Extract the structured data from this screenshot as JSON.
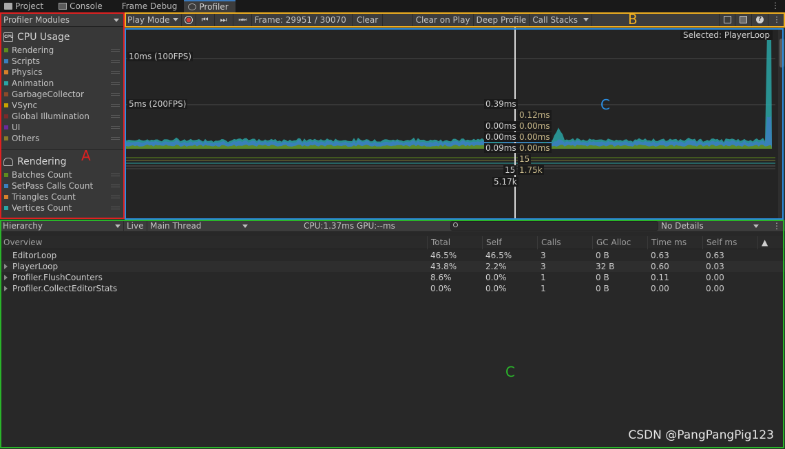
{
  "tabs": [
    {
      "label": "Project",
      "icon": "folder-icon",
      "active": false
    },
    {
      "label": "Console",
      "icon": "console-icon",
      "active": false
    },
    {
      "label": "Frame Debug",
      "icon": "",
      "active": false
    },
    {
      "label": "Profiler",
      "icon": "profiler-icon",
      "active": true
    }
  ],
  "tab_menu": "⋮",
  "modules": {
    "header": "Profiler Modules",
    "cpu": {
      "title": "CPU Usage",
      "badge": "CPU",
      "items": [
        {
          "label": "Rendering",
          "color": "#5f8c1d"
        },
        {
          "label": "Scripts",
          "color": "#3b7fbd"
        },
        {
          "label": "Physics",
          "color": "#d6802c"
        },
        {
          "label": "Animation",
          "color": "#2aa5a5"
        },
        {
          "label": "GarbageCollector",
          "color": "#8a4a2a"
        },
        {
          "label": "VSync",
          "color": "#c7a400"
        },
        {
          "label": "Global Illumination",
          "color": "#7a2a2a"
        },
        {
          "label": "UI",
          "color": "#6a2a9a"
        },
        {
          "label": "Others",
          "color": "#8a7a2a"
        }
      ]
    },
    "rendering": {
      "title": "Rendering",
      "items": [
        {
          "label": "Batches Count",
          "color": "#5f8c1d"
        },
        {
          "label": "SetPass Calls Count",
          "color": "#3b7fbd"
        },
        {
          "label": "Triangles Count",
          "color": "#d6802c"
        },
        {
          "label": "Vertices Count",
          "color": "#2aa5a5"
        }
      ]
    }
  },
  "toolbar": {
    "play_mode": "Play Mode",
    "prev_frame": "⏮",
    "next_frame": "⏭",
    "last_frame": "⏭⏭",
    "frame_label": "Frame: 29951 / 30070",
    "clear": "Clear",
    "clear_on_play": "Clear on Play",
    "deep_profile": "Deep Profile",
    "call_stacks": "Call Stacks",
    "help": "?"
  },
  "chart": {
    "selected": "Selected: PlayerLoop",
    "ms_10": "10ms (100FPS)",
    "ms_5": "5ms (200FPS)",
    "cursor_labels": {
      "left": [
        "0.39ms",
        "0.00ms",
        "0.00ms",
        "0.09ms",
        "15",
        "5.17k"
      ],
      "right": [
        "0.12ms",
        "0.00ms",
        "0.00ms",
        "0.00ms",
        "15",
        "1.75k"
      ]
    },
    "colors": {
      "scripts": "#3b7fbd",
      "rendering": "#5f8c1d",
      "teal": "#2aa5a5",
      "vsync": "#c7a400",
      "cursor": "#d9d9d9"
    }
  },
  "details": {
    "view": "Hierarchy",
    "live": "Live",
    "thread": "Main Thread",
    "timing": "CPU:1.37ms   GPU:--ms",
    "no_details": "No Details",
    "columns": [
      "Overview",
      "Total",
      "Self",
      "Calls",
      "GC Alloc",
      "Time ms",
      "Self ms",
      "▲"
    ],
    "rows": [
      {
        "name": "EditorLoop",
        "total": "46.5%",
        "self": "46.5%",
        "calls": "3",
        "gc": "0 B",
        "time": "0.63",
        "selfms": "0.63",
        "expandable": false
      },
      {
        "name": "PlayerLoop",
        "total": "43.8%",
        "self": "2.2%",
        "calls": "3",
        "gc": "32 B",
        "time": "0.60",
        "selfms": "0.03",
        "expandable": true
      },
      {
        "name": "Profiler.FlushCounters",
        "total": "8.6%",
        "self": "0.0%",
        "calls": "1",
        "gc": "0 B",
        "time": "0.11",
        "selfms": "0.00",
        "expandable": true
      },
      {
        "name": "Profiler.CollectEditorStats",
        "total": "0.0%",
        "self": "0.0%",
        "calls": "1",
        "gc": "0 B",
        "time": "0.00",
        "selfms": "0.00",
        "expandable": true
      }
    ]
  },
  "annotations": {
    "A": {
      "letter": "A",
      "color": "#e02020"
    },
    "B": {
      "letter": "B",
      "color": "#f0b020"
    },
    "C_top": {
      "letter": "C",
      "color": "#2a8de0"
    },
    "C_bottom": {
      "letter": "C",
      "color": "#2ab52a"
    }
  },
  "watermark": "CSDN @PangPangPig123"
}
